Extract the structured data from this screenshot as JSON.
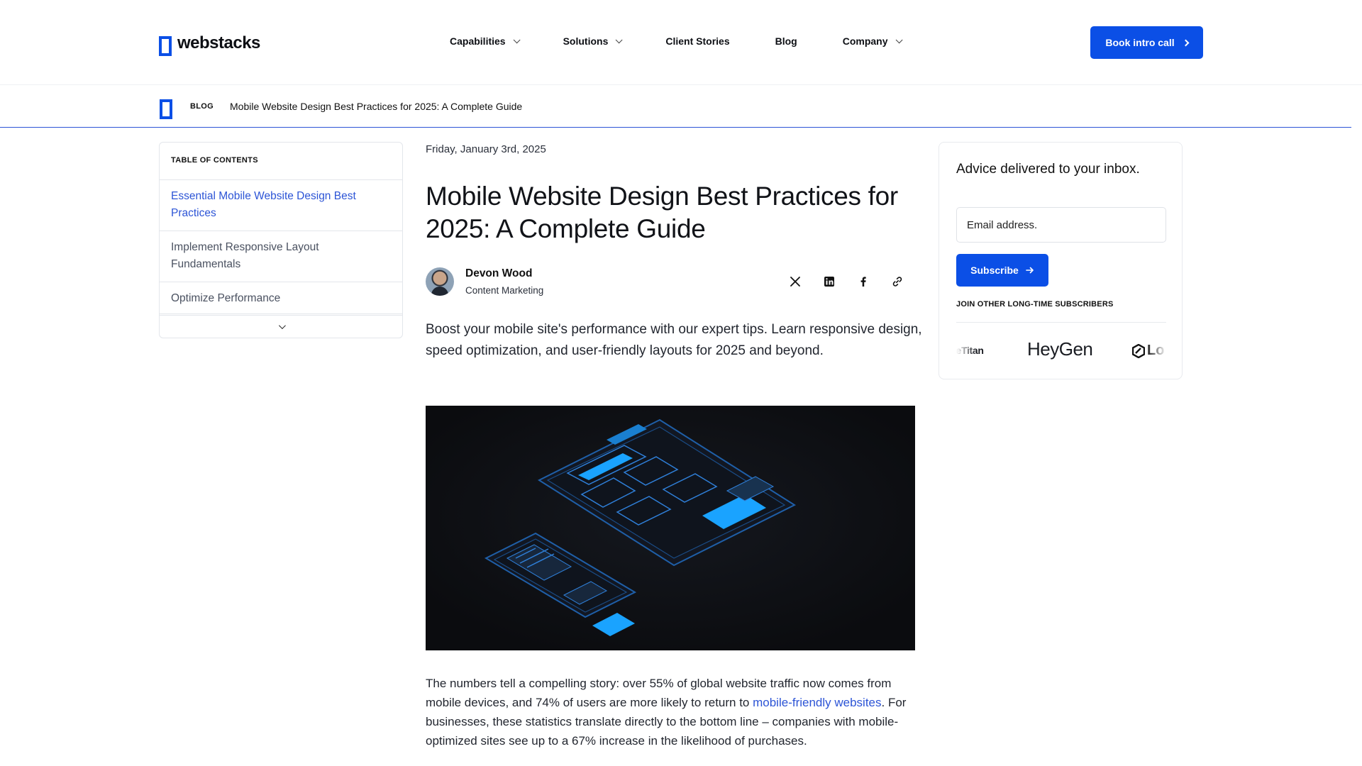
{
  "nav": {
    "logo_text": "webstacks",
    "menu": [
      {
        "label": "Capabilities",
        "has_dropdown": true
      },
      {
        "label": "Solutions",
        "has_dropdown": true
      },
      {
        "label": "Client Stories",
        "has_dropdown": false
      },
      {
        "label": "Blog",
        "has_dropdown": false
      },
      {
        "label": "Company",
        "has_dropdown": true
      }
    ],
    "cta_label": "Book intro call"
  },
  "breadcrumb": {
    "section": "BLOG",
    "current": "Mobile Website Design Best Practices for 2025: A Complete Guide"
  },
  "toc": {
    "heading": "TABLE OF CONTENTS",
    "items": [
      {
        "label": "Essential Mobile Website Design Best Practices",
        "active": true
      },
      {
        "label": "Implement Responsive Layout Fundamentals",
        "active": false
      },
      {
        "label": "Optimize Performance",
        "active": false
      }
    ]
  },
  "article": {
    "date": "Friday, January 3rd, 2025",
    "title": "Mobile Website Design Best Practices for 2025: A Complete Guide",
    "author_name": "Devon Wood",
    "author_role": "Content Marketing",
    "share_icons": [
      "x-icon",
      "linkedin-icon",
      "facebook-icon",
      "link-icon"
    ],
    "lead": "Boost your mobile site's performance with our expert tips. Learn responsive design, speed optimization, and user-friendly layouts for 2025 and beyond.",
    "body_part1": "The numbers tell a compelling story: over 55% of global website traffic now comes from mobile devices, and 74% of users are more likely to return to ",
    "body_link": "mobile-friendly websites",
    "body_part2": ". For businesses, these statistics translate directly to the bottom line – companies with mobile-optimized sites see up to a 67% increase in the likelihood of purchases."
  },
  "newsletter": {
    "title": "Advice delivered to your inbox.",
    "email_placeholder": "Email address.",
    "button_label": "Subscribe",
    "note": "JOIN OTHER LONG-TIME SUBSCRIBERS",
    "logos": [
      "ceTitan",
      "HeyGen",
      "Lo"
    ]
  },
  "colors": {
    "accent": "#0b4fe6",
    "link": "#2c54d6",
    "hero_bg": "#0d0e11",
    "hero_glow": "#1aa3ff"
  }
}
